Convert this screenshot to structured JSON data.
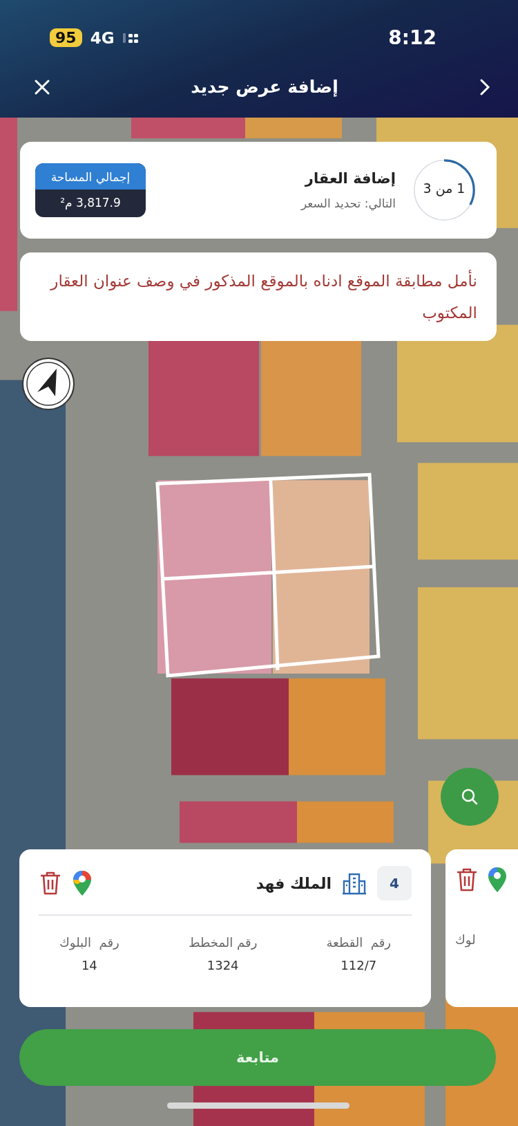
{
  "status_bar": {
    "battery": "95",
    "network": "4G",
    "time": "8:12"
  },
  "header": {
    "title": "إضافة عرض جديد"
  },
  "progress": {
    "step": "1 من 3",
    "level": 0.33,
    "title": "إضافة العقار",
    "next": "التالي: تحديد السعر",
    "area_label": "إجمالي المساحة",
    "area_value": "3,817.9 م²"
  },
  "notice": {
    "text": "نأمل مطابقة الموقع ادناه بالموقع المذكور في وصف عنوان العقار المكتوب"
  },
  "property_cards": [
    {
      "number": "4",
      "street": "الملك فهد",
      "fields": [
        {
          "label": "رقم  القطعة",
          "value": "112/7"
        },
        {
          "label": "رقم المخطط",
          "value": "1324"
        },
        {
          "label": "رقم  البلوك",
          "value": "14"
        }
      ]
    }
  ],
  "next_card": {
    "label": "لوك"
  },
  "continue_button": {
    "label": "متابعة"
  }
}
